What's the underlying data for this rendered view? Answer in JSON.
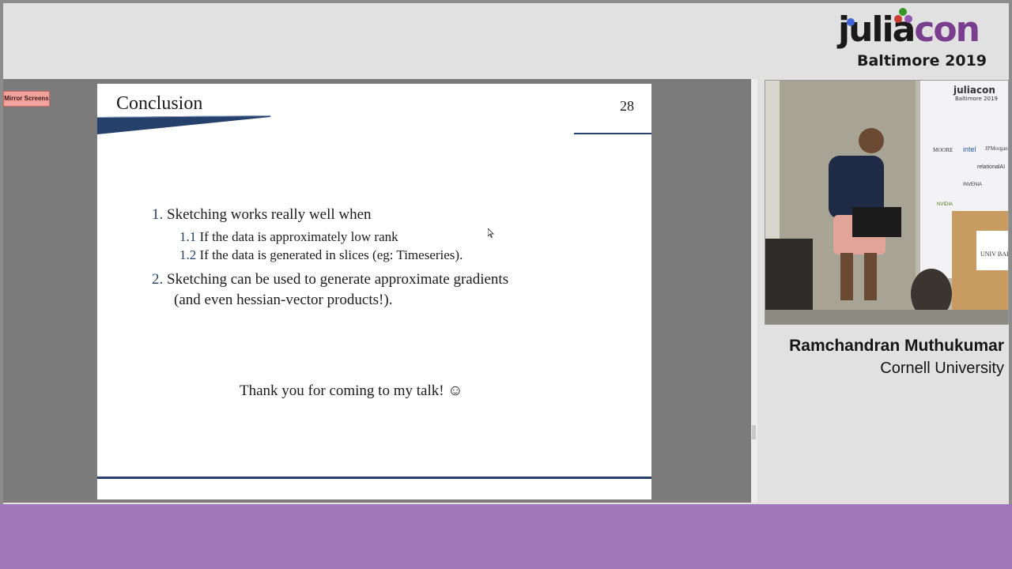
{
  "branding": {
    "logo_word_left": "julia",
    "logo_word_right": "con",
    "logo_subtitle": "Baltimore 2019",
    "colors": {
      "julia_red": "#cb3c33",
      "julia_green": "#389826",
      "julia_purple": "#9558b2",
      "con_purple": "#7a3e8f",
      "blue": "#4063d8"
    }
  },
  "screen": {
    "badge_label": "Mirror Screens"
  },
  "slide": {
    "title": "Conclusion",
    "page_number": "28",
    "items": [
      {
        "number": "1.",
        "text": "Sketching works really well when"
      },
      {
        "number": "2.",
        "text": "Sketching can be used to generate approximate gradients",
        "continuation": "(and even hessian-vector products!)."
      }
    ],
    "subitems": [
      {
        "number": "1.1",
        "text": "If the data is approximately low rank"
      },
      {
        "number": "1.2",
        "text": "If the data is generated in slices (eg: Timeseries)."
      }
    ],
    "closing": "Thank you for coming to my talk! ☺",
    "accent_color": "#25406b"
  },
  "video": {
    "backdrop_logo": "juliacon",
    "backdrop_subtitle": "Baltimore 2019",
    "sponsors": [
      "intel",
      "JPMorgan",
      "relationalAI",
      "MOORE",
      "INVENIA",
      "NVIDIA"
    ],
    "podium_text": "UNIV BALTI"
  },
  "speaker": {
    "name": "Ramchandran Muthukumar",
    "affiliation": "Cornell University"
  },
  "colors": {
    "bottom_band": "#a177bc",
    "background": "#e1e1e1"
  }
}
